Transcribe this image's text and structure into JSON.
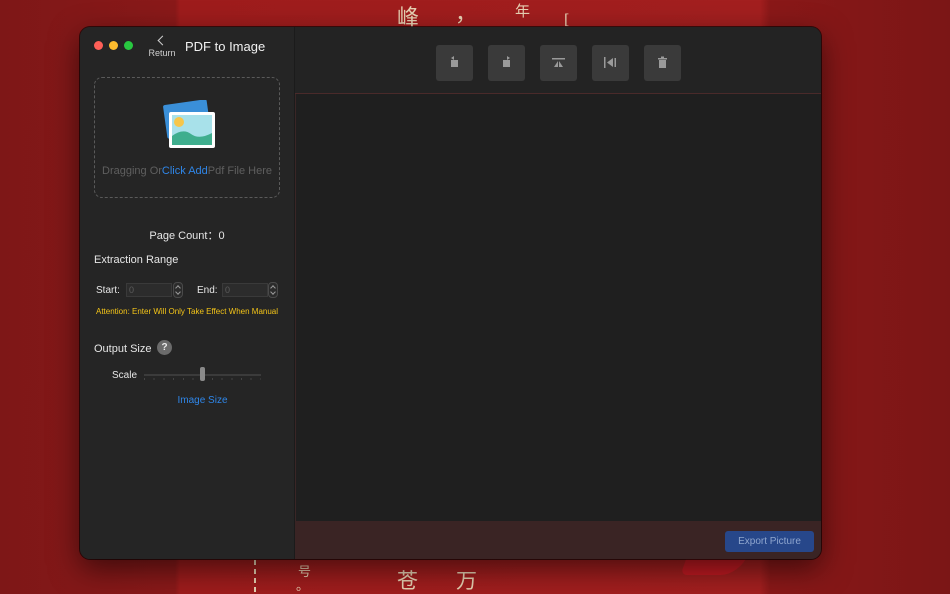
{
  "wallpaper": {
    "chars": [
      "峰",
      "，",
      "年",
      "号",
      "。",
      "苍",
      "万",
      "["
    ]
  },
  "window": {
    "return_label": "Return",
    "title": "PDF to Image"
  },
  "dropzone": {
    "text_before": "Dragging Or",
    "link_text": "Click Add",
    "text_after": "Pdf File Here"
  },
  "page_count": {
    "label": "Page Count：",
    "value": "0"
  },
  "extraction": {
    "title": "Extraction Range",
    "start_label": "Start:",
    "start_placeholder": "0",
    "end_label": "End:",
    "end_placeholder": "0",
    "attention": "Attention: Enter Will Only Take Effect When Manual"
  },
  "output": {
    "title": "Output Size",
    "help": "?",
    "scale_label": "Scale",
    "image_size_link": "Image Size"
  },
  "toolbar": {
    "buttons": [
      "rotate-left",
      "rotate-right",
      "flip-vertical",
      "flip-horizontal",
      "delete"
    ]
  },
  "footer": {
    "export_label": "Export Picture"
  },
  "colors": {
    "accent": "#2f86e8",
    "attention": "#f5c518",
    "export_bg": "#27478a",
    "wallpaper": "#a31f1f"
  }
}
